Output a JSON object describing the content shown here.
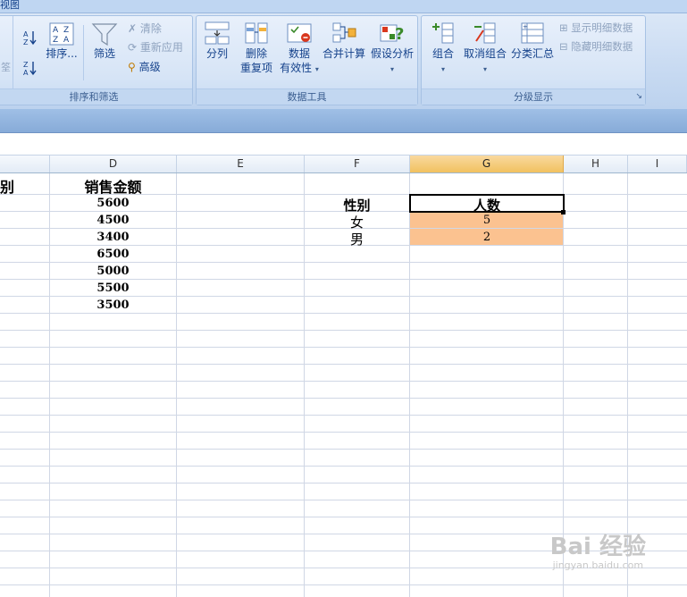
{
  "ribbon": {
    "tab_fragment": "视图",
    "sort_filter": {
      "caption": "排序和筛选",
      "left_partial": "筌",
      "sort_az_label": "A↓Z",
      "sort_za_label": "Z↓A",
      "sort_button": "排序...",
      "filter_button": "筛选",
      "clear": "清除",
      "reapply": "重新应用",
      "advanced": "高级"
    },
    "data_tools": {
      "caption": "数据工具",
      "text_to_columns": "分列",
      "remove_duplicates_1": "删除",
      "remove_duplicates_2": "重复项",
      "validation_1": "数据",
      "validation_2": "有效性",
      "consolidate": "合并计算",
      "what_if": "假设分析"
    },
    "outline": {
      "caption": "分级显示",
      "group": "组合",
      "ungroup": "取消组合",
      "subtotal": "分类汇总",
      "show_detail": "显示明细数据",
      "hide_detail": "隐藏明细数据"
    }
  },
  "columns": [
    "D",
    "E",
    "F",
    "G",
    "H",
    "I"
  ],
  "sheet": {
    "col_c_partial": "别",
    "sales_header": "销售金额",
    "sales_values": [
      "5600",
      "4500",
      "3400",
      "6500",
      "5000",
      "5500",
      "3500"
    ],
    "summary_header_gender": "性别",
    "summary_header_count": "人数",
    "summary_rows": [
      {
        "gender": "女",
        "count": "5"
      },
      {
        "gender": "男",
        "count": "2"
      }
    ]
  },
  "watermark": "Bai 经验",
  "watermark_sub": "jingyan.baidu.com"
}
